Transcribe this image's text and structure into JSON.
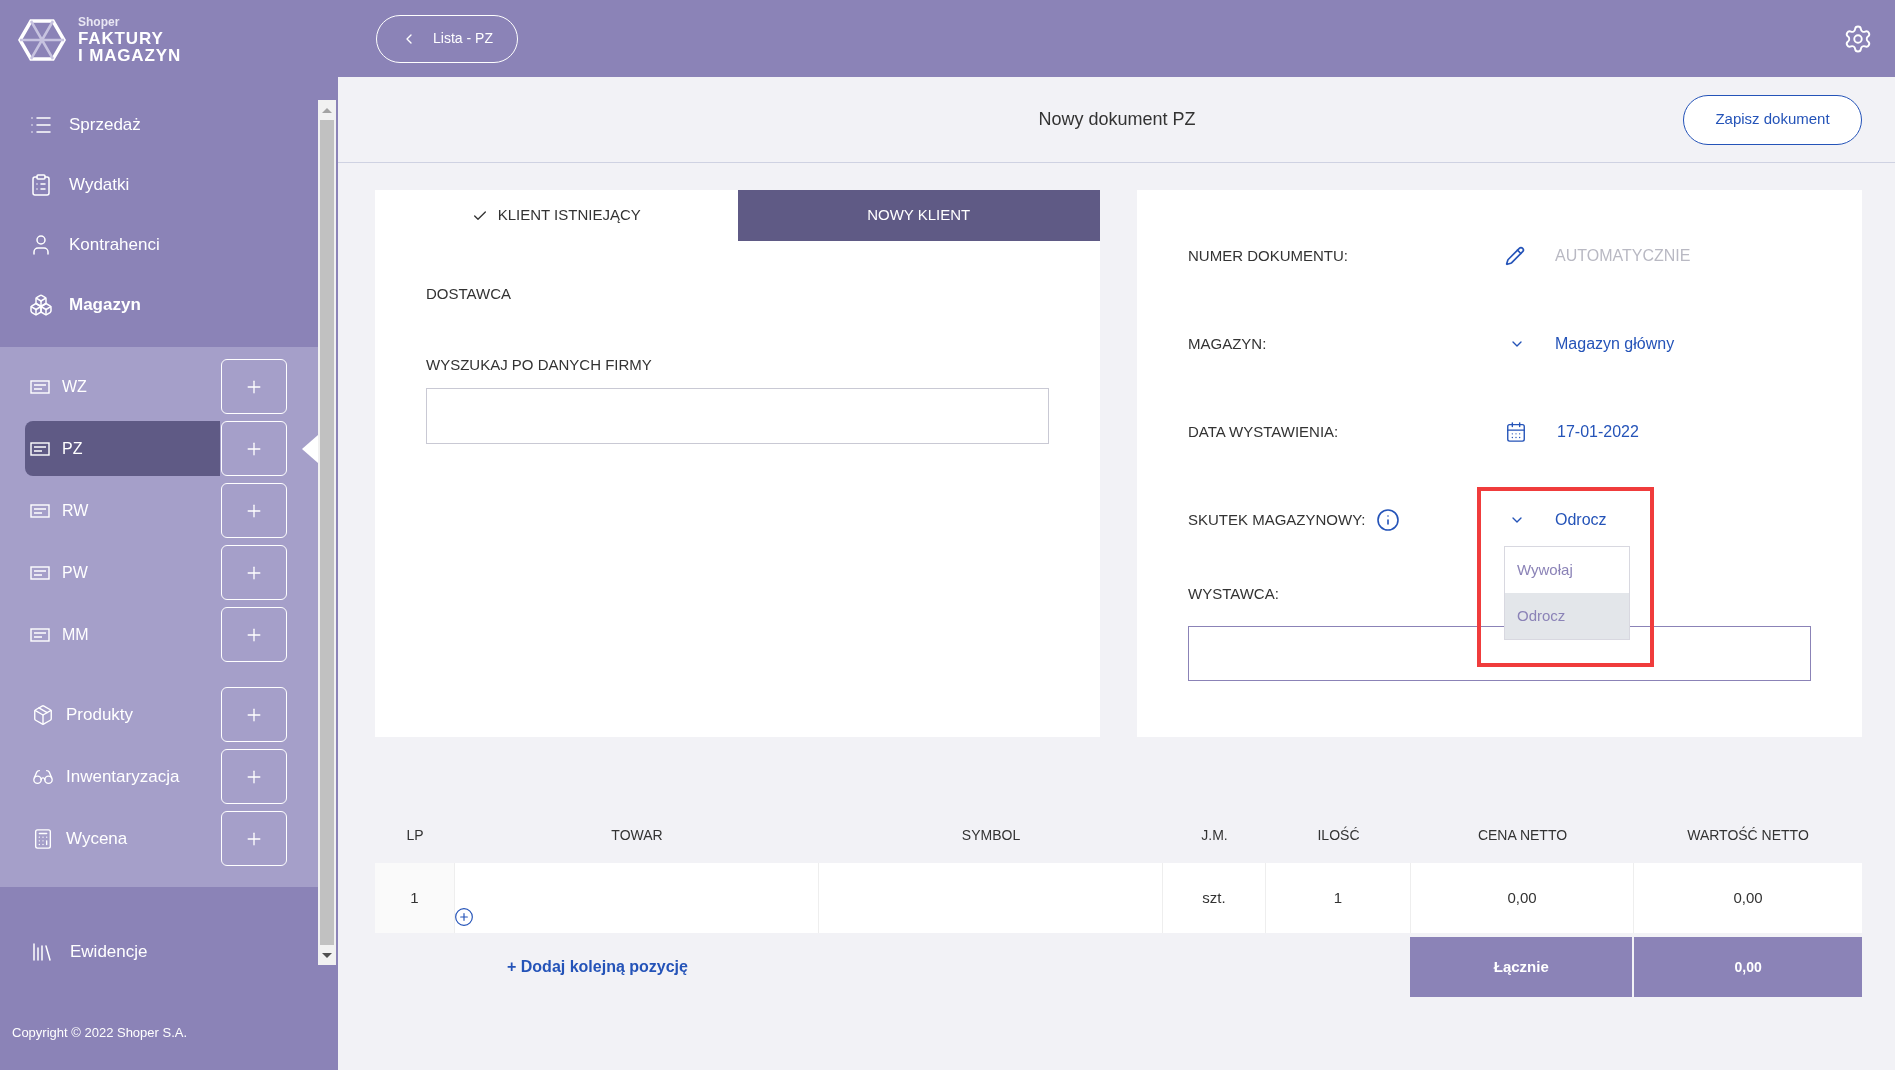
{
  "sidebar": {
    "logo": {
      "brand": "Shoper",
      "line_1": "FAKTURY",
      "line_2": "I MAGAZYN"
    },
    "main_items": [
      {
        "label": "Sprzedaż",
        "kind": "list",
        "expanded": false
      },
      {
        "label": "Wydatki",
        "kind": "clipboard",
        "expanded": false
      },
      {
        "label": "Kontrahenci",
        "kind": "user",
        "expanded": false
      },
      {
        "label": "Magazyn",
        "kind": "boxes",
        "expanded": true
      }
    ],
    "document_items": [
      {
        "label": "WZ",
        "selected": false
      },
      {
        "label": "PZ",
        "selected": true
      },
      {
        "label": "RW",
        "selected": false
      },
      {
        "label": "PW",
        "selected": false
      },
      {
        "label": "MM",
        "selected": false
      }
    ],
    "tool_items": [
      {
        "label": "Produkty",
        "kind": "package"
      },
      {
        "label": "Inwentaryzacja",
        "kind": "glasses"
      },
      {
        "label": "Wycena",
        "kind": "pricing"
      }
    ],
    "footer_item": {
      "label": "Ewidencje"
    },
    "copyright": "Copyright © 2022 Shoper S.A."
  },
  "top_bar": {
    "back_button": "Lista - PZ"
  },
  "header": {
    "title": "Nowy dokument PZ",
    "save_button": "Zapisz dokument"
  },
  "client_card": {
    "tabs": [
      {
        "label": "KLIENT ISTNIEJĄCY",
        "selected": true
      },
      {
        "label": "NOWY KLIENT",
        "selected": false
      }
    ],
    "section_label": "DOSTAWCA",
    "search_label": "WYSZUKAJ PO DANYCH FIRMY"
  },
  "document_card": {
    "fields": [
      {
        "kind": "edit",
        "label": "NUMER DOKUMENTU:",
        "value": "AUTOMATYCZNIE"
      },
      {
        "kind": "select",
        "label": "MAGAZYN:",
        "value": "Magazyn główny"
      },
      {
        "kind": "date",
        "label": "DATA WYSTAWIENIA:",
        "value": "17-01-2022"
      },
      {
        "kind": "select",
        "label": "SKUTEK MAGAZYNOWY:",
        "value": "Odrocz",
        "info": true,
        "expanded": true,
        "highlighted": true,
        "options": [
          {
            "label": "Wywołaj",
            "selected": false
          },
          {
            "label": "Odrocz",
            "selected": true
          }
        ]
      }
    ],
    "issuer_label": "WYSTAWCA:"
  },
  "table": {
    "columns": [
      "LP",
      "TOWAR",
      "SYMBOL",
      "J.M.",
      "ILOŚĆ",
      "CENA NETTO",
      "WARTOŚĆ NETTO"
    ],
    "rows": [
      {
        "lp": "1",
        "unit": "szt.",
        "quantity": "1",
        "net_price": "0,00",
        "net_value": "0,00"
      }
    ],
    "add_link": "+ Dodaj kolejną pozycję",
    "total_label": "Łącznie",
    "total_value": "0,00"
  }
}
